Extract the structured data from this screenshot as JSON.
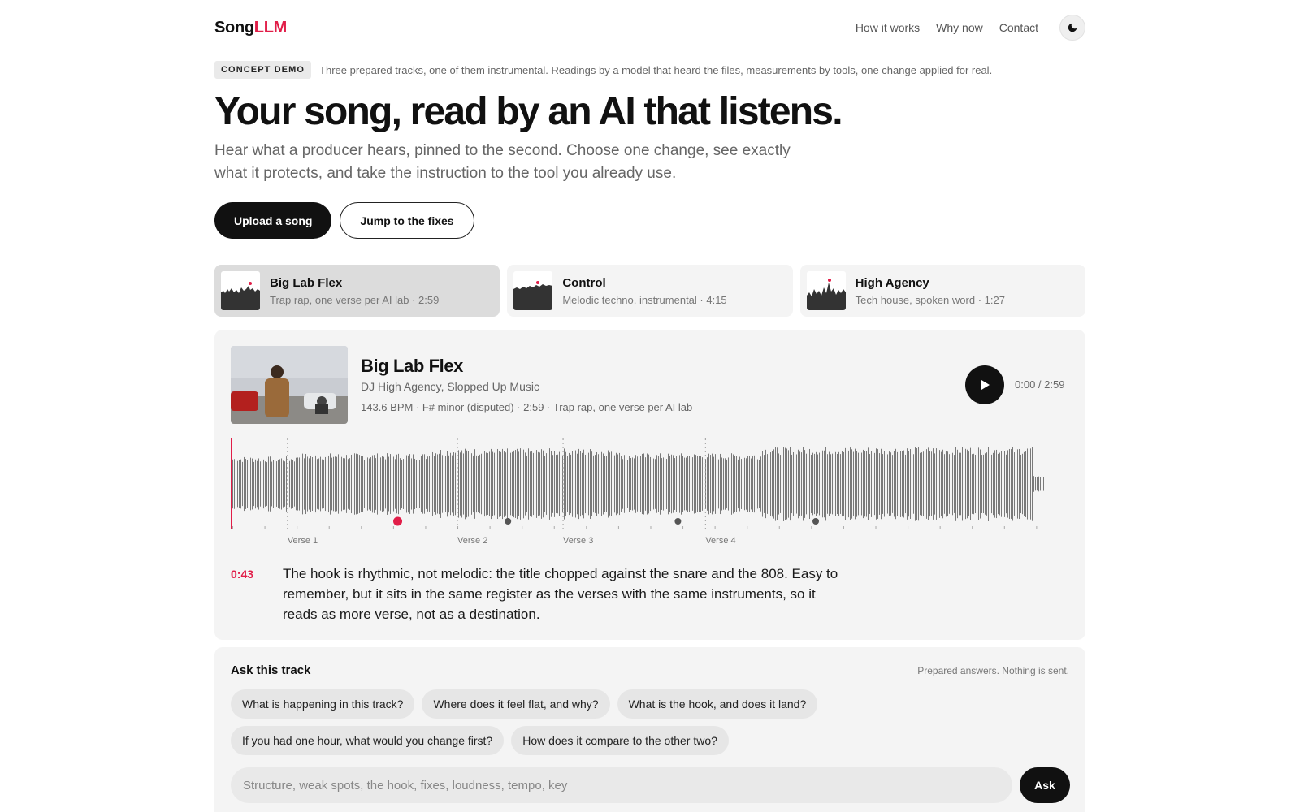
{
  "nav": {
    "logo_main": "Song",
    "logo_accent": "LLM",
    "links": [
      "How it works",
      "Why now",
      "Contact"
    ],
    "theme_icon": "moon-icon"
  },
  "concept": {
    "badge": "CONCEPT DEMO",
    "text": "Three prepared tracks, one of them instrumental. Readings by a model that heard the files, measurements by tools, one change applied for real."
  },
  "hero": {
    "title": "Your song, read by an AI that listens.",
    "subtitle": "Hear what a producer hears, pinned to the second. Choose one change, see exactly what it protects, and take the instruction to the tool you already use.",
    "primary_cta": "Upload a song",
    "secondary_cta": "Jump to the fixes"
  },
  "tracks": [
    {
      "title": "Big Lab Flex",
      "meta": "Trap rap, one verse per AI lab · 2:59",
      "active": true
    },
    {
      "title": "Control",
      "meta": "Melodic techno, instrumental · 4:15",
      "active": false
    },
    {
      "title": "High Agency",
      "meta": "Tech house, spoken word · 1:27",
      "active": false
    }
  ],
  "player": {
    "title": "Big Lab Flex",
    "artist": "DJ High Agency, Slopped Up Music",
    "meta": "143.6 BPM · F# minor (disputed) · 2:59 · Trap rap, one verse per AI lab",
    "time": "0:00 / 2:59",
    "play_icon": "play-icon",
    "duration_sec": 179,
    "section_labels": [
      "Verse 1",
      "Verse 2",
      "Verse 3",
      "Verse 4"
    ],
    "section_times_sec": [
      12,
      49,
      72,
      103
    ],
    "markers_sec": [
      36,
      60,
      97,
      127
    ],
    "active_marker_sec": 36,
    "note_time": "0:43",
    "note_text": "The hook is rhythmic, not melodic: the title chopped against the snare and the 808. Easy to remember, but it sits in the same register as the verses with the same instruments, so it reads as more verse, not as a destination.",
    "accent_color": "#e11d48"
  },
  "ask": {
    "title": "Ask this track",
    "note": "Prepared answers. Nothing is sent.",
    "chips": [
      "What is happening in this track?",
      "Where does it feel flat, and why?",
      "What is the hook, and does it land?",
      "If you had one hour, what would you change first?",
      "How does it compare to the other two?"
    ],
    "placeholder": "Structure, weak spots, the hook, fixes, loudness, tempo, key",
    "button": "Ask"
  }
}
